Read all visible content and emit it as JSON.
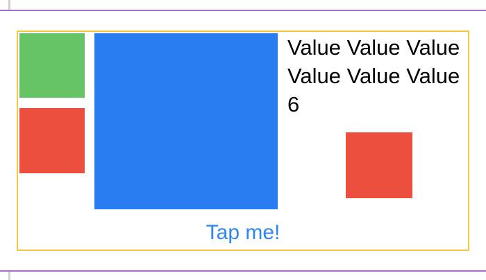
{
  "content": {
    "value_text": "Value Value Value Value Value Value 6"
  },
  "button": {
    "label": "Tap me!"
  },
  "colors": {
    "frame_border": "#f6c945",
    "divider": "#a96fd0",
    "green": "#67c466",
    "red": "#ec4f3e",
    "blue": "#2a7cf1",
    "link": "#2f86f0"
  }
}
